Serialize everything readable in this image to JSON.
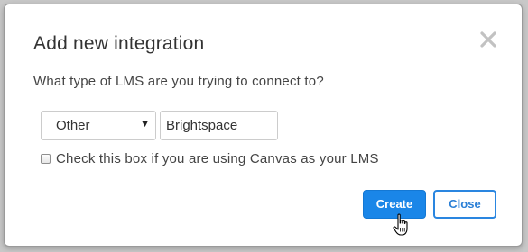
{
  "dialog": {
    "title": "Add new integration",
    "close_icon": "close-x-icon",
    "question": "What type of LMS are you trying to connect to?",
    "lms_select": {
      "selected": "Other"
    },
    "lms_name_input": {
      "value": "Brightspace"
    },
    "canvas_checkbox": {
      "checked": false,
      "label": "Check this box if you are using Canvas as your LMS"
    },
    "buttons": {
      "create_label": "Create",
      "close_label": "Close"
    }
  },
  "colors": {
    "primary": "#1a86e8",
    "backdrop": "#c8c8c8",
    "title_text": "#333333"
  }
}
